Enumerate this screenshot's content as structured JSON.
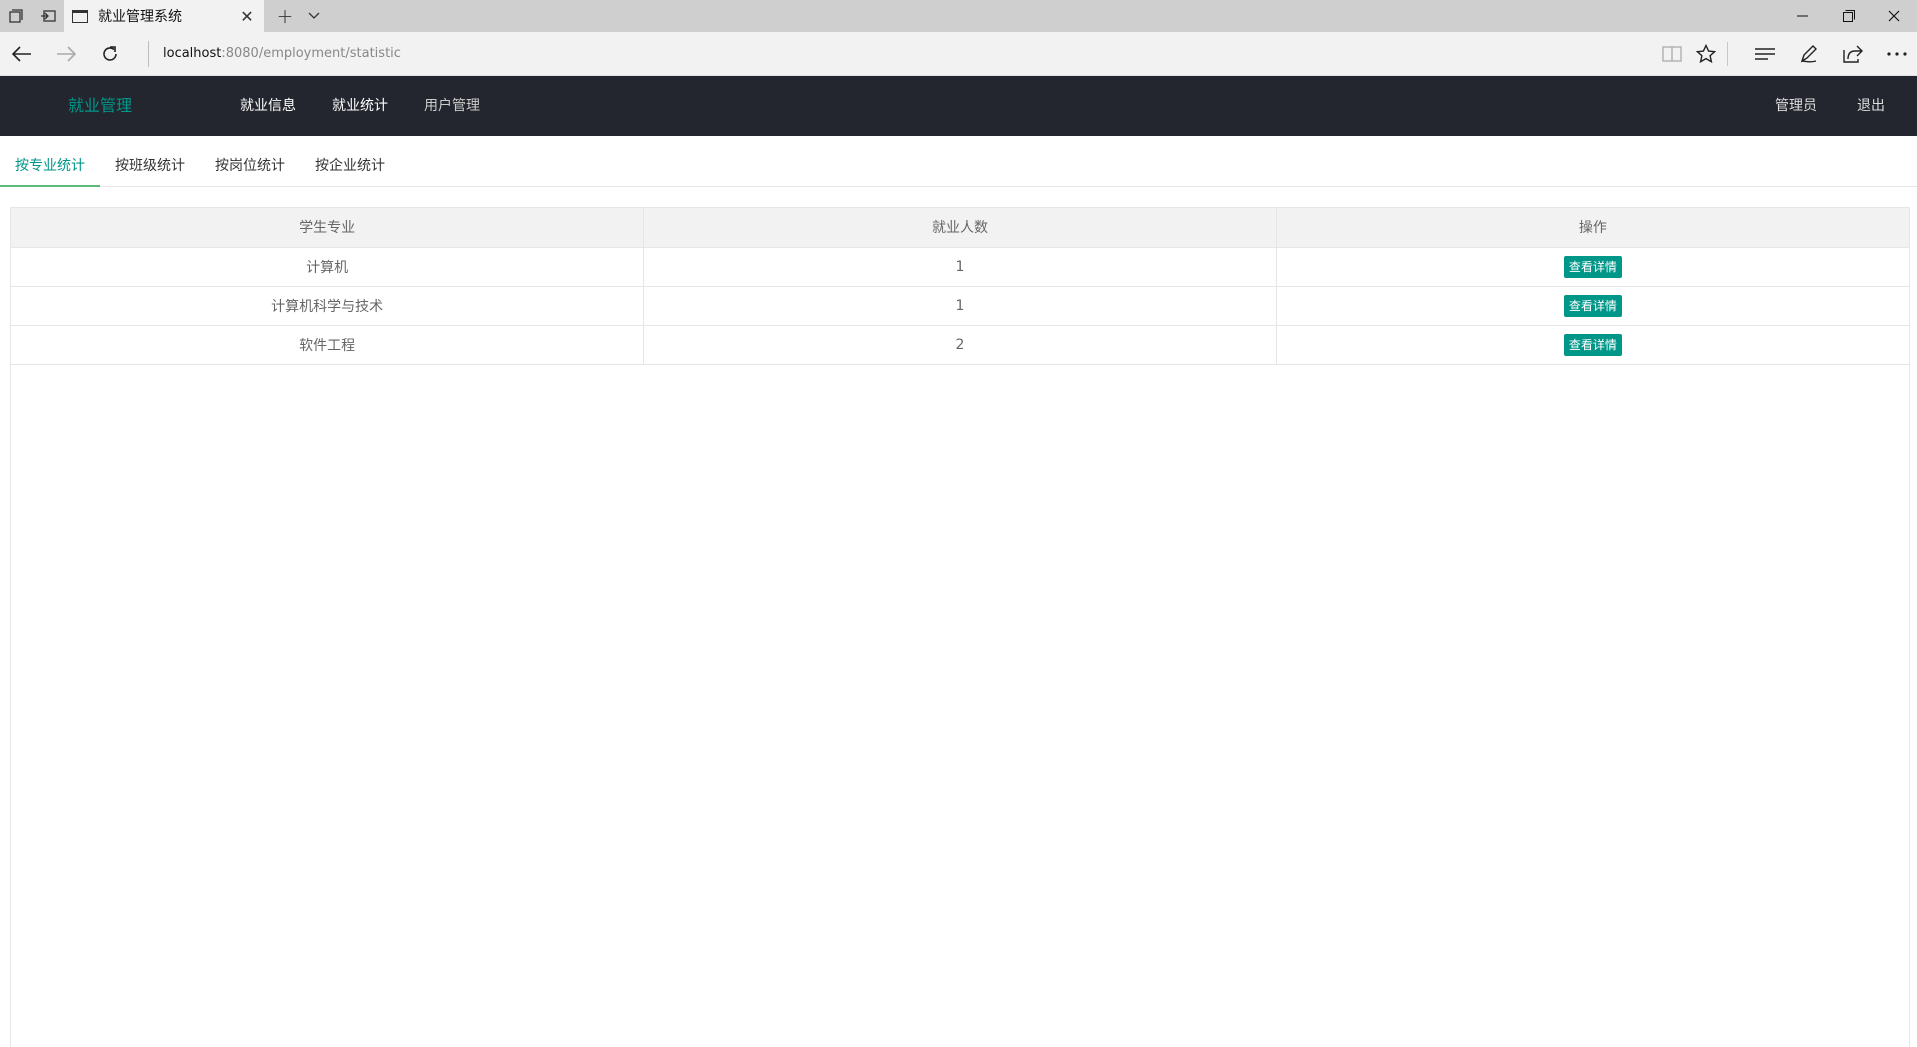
{
  "browser": {
    "tab_title": "就业管理系统",
    "url_host": "localhost",
    "url_rest": ":8080/employment/statistic"
  },
  "header": {
    "logo": "就业管理",
    "nav": [
      {
        "label": "就业信息"
      },
      {
        "label": "就业统计"
      },
      {
        "label": "用户管理"
      }
    ],
    "user_label": "管理员",
    "logout_label": "退出"
  },
  "subtabs": [
    {
      "label": "按专业统计",
      "active": true
    },
    {
      "label": "按班级统计",
      "active": false
    },
    {
      "label": "按岗位统计",
      "active": false
    },
    {
      "label": "按企业统计",
      "active": false
    }
  ],
  "table": {
    "columns": [
      "学生专业",
      "就业人数",
      "操作"
    ],
    "rows": [
      {
        "major": "计算机",
        "count": "1",
        "action": "查看详情"
      },
      {
        "major": "计算机科学与技术",
        "count": "1",
        "action": "查看详情"
      },
      {
        "major": "软件工程",
        "count": "2",
        "action": "查看详情"
      }
    ]
  },
  "theme": {
    "accent": "#009688",
    "header_bg": "#23262e"
  }
}
